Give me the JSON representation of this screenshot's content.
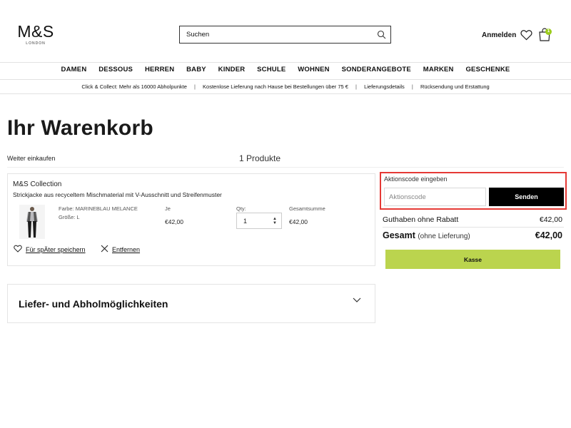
{
  "header": {
    "logo_main": "M&S",
    "logo_sub": "LONDON",
    "search_placeholder": "Suchen",
    "login_label": "Anmelden",
    "bag_count": "1"
  },
  "nav": [
    "DAMEN",
    "DESSOUS",
    "HERREN",
    "BABY",
    "KINDER",
    "SCHULE",
    "WOHNEN",
    "SONDERANGEBOTE",
    "MARKEN",
    "GESCHENKE"
  ],
  "promo_bar": [
    "Click & Collect: Mehr als 16000 Abholpunkte",
    "Kostenlose Lieferung nach Hause bei Bestellungen über 75 €",
    "Lieferungsdetails",
    "Rücksendung und Erstattung"
  ],
  "page": {
    "title": "Ihr Warenkorb",
    "continue_shopping": "Weiter einkaufen",
    "product_count": "1 Produkte"
  },
  "cart_item": {
    "brand": "M&S Collection",
    "description": "Strickjacke aus recyceltem Mischmaterial mit V-Ausschnitt und Streifenmuster",
    "color": "Farbe: MARINEBLAU MELANCE",
    "size": "Größe: L",
    "unit_price_label": "Je",
    "unit_price": "€42,00",
    "qty_label": "Qty:",
    "qty_value": "1",
    "total_label": "Gesamtsumme",
    "total": "€42,00",
    "save_later": "Für spÄter speichern",
    "remove": "Entfernen"
  },
  "delivery": {
    "title": "Liefer- und Abholmöglichkeiten"
  },
  "promo_code": {
    "label": "Aktionscode eingeben",
    "placeholder": "Aktionscode",
    "send": "Senden"
  },
  "summary": {
    "subtotal_label": "Guthaben ohne Rabatt",
    "subtotal": "€42,00",
    "total_label": "Gesamt",
    "total_note": "(ohne Lieferung)",
    "total": "€42,00",
    "checkout": "Kasse"
  },
  "colors": {
    "accent_green": "#bbd44e",
    "badge_green": "#9ccc1c",
    "highlight_red": "#e53935"
  }
}
